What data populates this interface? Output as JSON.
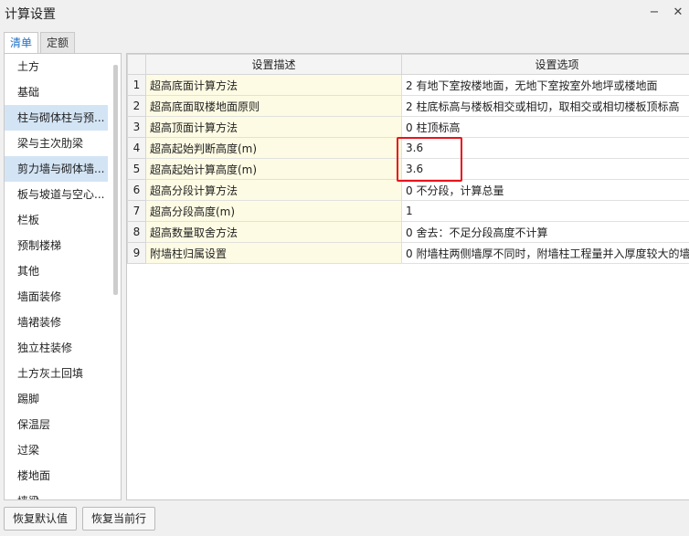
{
  "window": {
    "title": "计算设置",
    "minimize_glyph": "−",
    "close_glyph": "✕"
  },
  "tabs": [
    {
      "label": "清单",
      "active": true
    },
    {
      "label": "定额",
      "active": false
    }
  ],
  "left_list": {
    "items": [
      {
        "label": "土方",
        "selected": false
      },
      {
        "label": "基础",
        "selected": false
      },
      {
        "label": "柱与砌体柱与预...",
        "selected": true
      },
      {
        "label": "梁与主次肋梁",
        "selected": false
      },
      {
        "label": "剪力墙与砌体墙...",
        "selected": true
      },
      {
        "label": "板与坡道与空心...",
        "selected": false
      },
      {
        "label": "栏板",
        "selected": false
      },
      {
        "label": "预制楼梯",
        "selected": false
      },
      {
        "label": "其他",
        "selected": false
      },
      {
        "label": "墙面装修",
        "selected": false
      },
      {
        "label": "墙裙装修",
        "selected": false
      },
      {
        "label": "独立柱装修",
        "selected": false
      },
      {
        "label": "土方灰土回填",
        "selected": false
      },
      {
        "label": "踢脚",
        "selected": false
      },
      {
        "label": "保温层",
        "selected": false
      },
      {
        "label": "过梁",
        "selected": false
      },
      {
        "label": "楼地面",
        "selected": false
      },
      {
        "label": "墙梁",
        "selected": false
      }
    ]
  },
  "grid": {
    "columns": [
      "",
      "设置描述",
      "设置选项"
    ],
    "rows": [
      {
        "idx": "1",
        "desc": "超高底面计算方法",
        "option": "2 有地下室按楼地面，无地下室按室外地坪或楼地面"
      },
      {
        "idx": "2",
        "desc": "超高底面取楼地面原则",
        "option": "2 柱底标高与楼板相交或相切，取相交或相切楼板顶标高"
      },
      {
        "idx": "3",
        "desc": "超高顶面计算方法",
        "option": "0 柱顶标高"
      },
      {
        "idx": "4",
        "desc": "超高起始判断高度(m)",
        "option": "3.6"
      },
      {
        "idx": "5",
        "desc": "超高起始计算高度(m)",
        "option": "3.6"
      },
      {
        "idx": "6",
        "desc": "超高分段计算方法",
        "option": "0 不分段，计算总量"
      },
      {
        "idx": "7",
        "desc": "超高分段高度(m)",
        "option": "1"
      },
      {
        "idx": "8",
        "desc": "超高数量取舍方法",
        "option": "0 舍去：不足分段高度不计算"
      },
      {
        "idx": "9",
        "desc": "附墙柱归属设置",
        "option": "0 附墙柱两侧墙厚不同时，附墙柱工程量并入厚度较大的墙"
      }
    ]
  },
  "footer": {
    "restore_default_label": "恢复默认值",
    "restore_current_row_label": "恢复当前行"
  },
  "colors": {
    "accent": "#1e6fc6",
    "selected_bg": "#d3e4f5",
    "desc_bg": "#fdfbe3",
    "highlight_border": "#e8141b"
  }
}
